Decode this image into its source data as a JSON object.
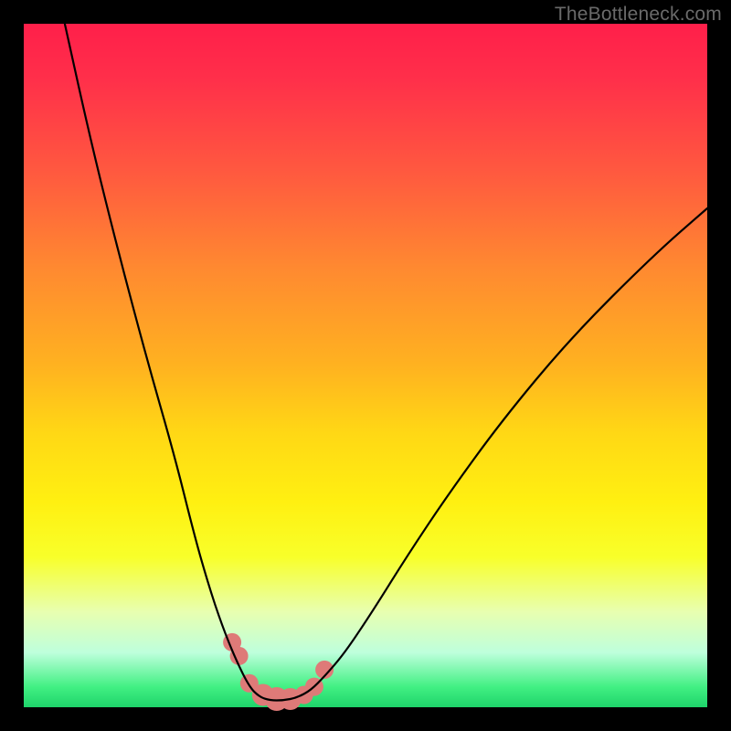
{
  "watermark": "TheBottleneck.com",
  "chart_data": {
    "type": "line",
    "title": "",
    "xlabel": "",
    "ylabel": "",
    "xlim": [
      0,
      100
    ],
    "ylim": [
      0,
      100
    ],
    "grid": false,
    "series": [
      {
        "name": "bottleneck-curve",
        "x": [
          6,
          10,
          14,
          18,
          22,
          25,
          27,
          29,
          31,
          33,
          34.5,
          36,
          38,
          40,
          42,
          44,
          47,
          51,
          56,
          62,
          70,
          80,
          92,
          100
        ],
        "values": [
          100,
          82,
          66,
          51,
          37,
          25,
          18,
          12,
          7,
          3,
          1.5,
          1,
          1,
          1.4,
          2.5,
          4.5,
          8,
          14,
          22,
          31,
          42,
          54,
          66,
          73
        ]
      }
    ],
    "markers": {
      "name": "highlight-cluster",
      "x": [
        30.5,
        31.5,
        33,
        35,
        37,
        39,
        41,
        42.5,
        44
      ],
      "values": [
        9.5,
        7.5,
        3.5,
        1.8,
        1.2,
        1.2,
        1.8,
        3,
        5.5
      ],
      "radius": [
        10,
        10,
        10,
        12,
        13,
        12,
        10,
        10,
        10
      ]
    },
    "gradient_stops": [
      {
        "pos": 0,
        "color": "#ff1f4a"
      },
      {
        "pos": 22,
        "color": "#ff5a3f"
      },
      {
        "pos": 50,
        "color": "#ffb220"
      },
      {
        "pos": 70,
        "color": "#fff011"
      },
      {
        "pos": 92,
        "color": "#beffdc"
      },
      {
        "pos": 100,
        "color": "#1ed46a"
      }
    ]
  }
}
